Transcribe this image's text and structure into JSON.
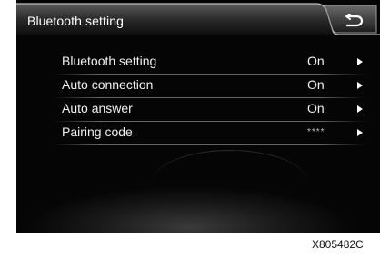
{
  "header": {
    "title": "Bluetooth setting",
    "back_icon": "return-icon"
  },
  "settings": [
    {
      "label": "Bluetooth setting",
      "value": "On"
    },
    {
      "label": "Auto connection",
      "value": "On"
    },
    {
      "label": "Auto answer",
      "value": "On"
    },
    {
      "label": "Pairing code",
      "value": "****"
    }
  ],
  "row_arrow_icon": "play-arrow-icon",
  "figure_code": "X805482C",
  "colors": {
    "background": "#0b0b0b",
    "text": "#f2f2f2",
    "divider": "#666666"
  }
}
